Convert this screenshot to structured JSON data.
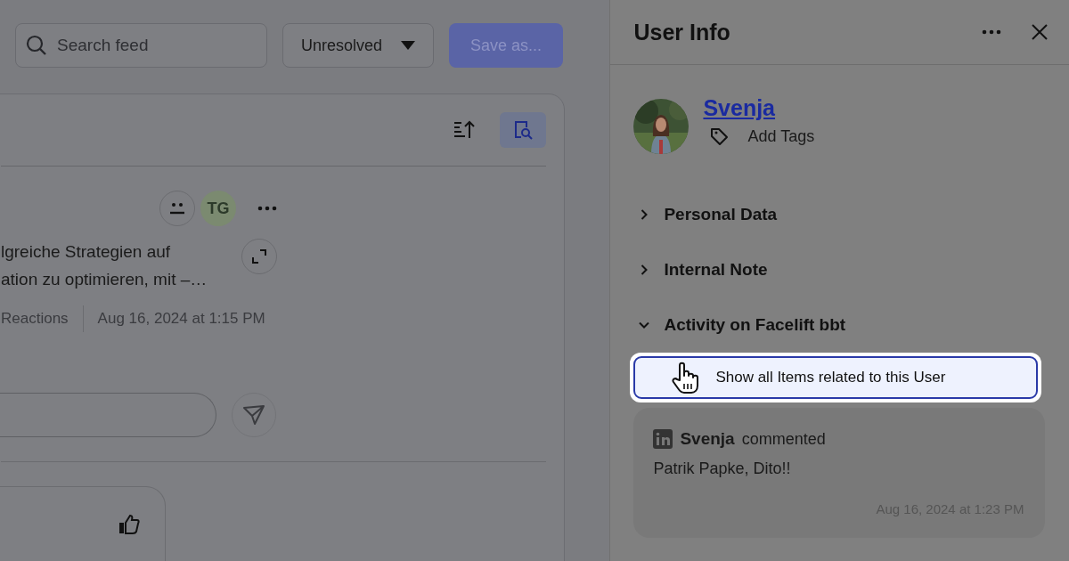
{
  "toolbar": {
    "search": {
      "placeholder": "Search feed"
    },
    "status_filter": {
      "value": "Unresolved"
    },
    "save_button": {
      "label": "Save as...",
      "disabled": true
    }
  },
  "feed": {
    "header": {
      "filter_active": true
    },
    "post": {
      "assignee_initials": "TG",
      "text_lines": [
        "lgreiche Strategien auf",
        "ation zu optimieren, mit –…"
      ],
      "reactions": "Reactions",
      "timestamp": "Aug 16, 2024 at 1:15 PM"
    }
  },
  "user_info": {
    "title": "User Info",
    "name": "Svenja",
    "add_tags": "Add Tags",
    "sections": [
      {
        "label": "Personal Data",
        "expanded": false
      },
      {
        "label": "Internal Note",
        "expanded": false
      },
      {
        "label": "Activity on Facelift bbt",
        "expanded": true
      }
    ],
    "show_all_button": "Show all Items related to this User",
    "activity": [
      {
        "author": "Svenja",
        "action": "commented",
        "text": "Patrik Papke, Dito!!",
        "timestamp": "Aug 16, 2024 at 1:23 PM"
      }
    ]
  }
}
